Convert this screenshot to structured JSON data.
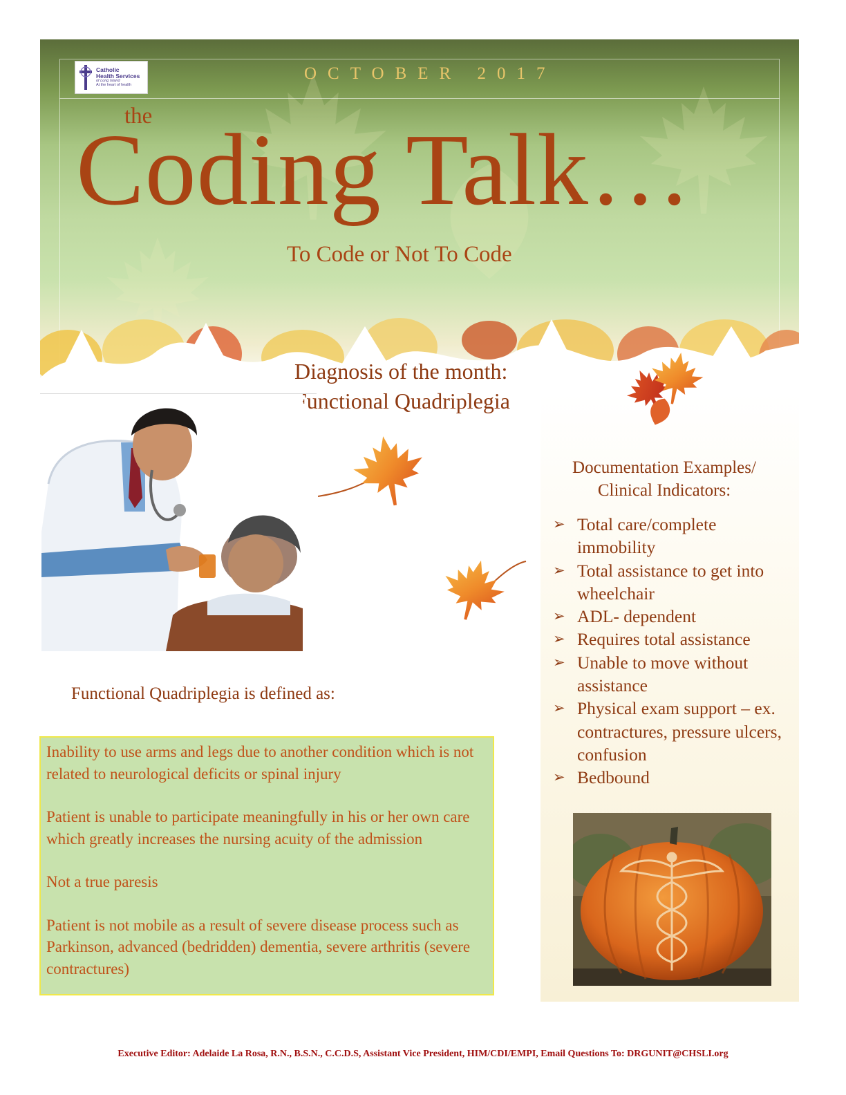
{
  "header": {
    "logo": {
      "line1": "Catholic",
      "line2": "Health Services",
      "line3": "of Long Island",
      "line4": "At the heart of health"
    },
    "date": "OCTOBER 2017",
    "title_prefix": "the",
    "title": "Coding Talk…",
    "subtitle": "To Code or Not To Code"
  },
  "diagnosis": {
    "line1": "Diagnosis of the month:",
    "line2": "Functional Quadriplegia"
  },
  "definition": {
    "heading": "Functional Quadriplegia is defined as:",
    "paragraphs": [
      "Inability to use arms and legs due to another condition which is not related to neurological deficits or spinal injury",
      "Patient is unable to participate meaningfully in his or her own care which greatly increases the nursing acuity of the admission",
      "Not a true paresis",
      "Patient is not mobile as a result of severe disease process such as Parkinson, advanced (bedridden) dementia, severe arthritis (severe contractures)"
    ]
  },
  "documentation": {
    "heading_line1": "Documentation Examples/",
    "heading_line2": "Clinical Indicators:",
    "items": [
      "Total care/complete immobility",
      "Total assistance to get into wheelchair",
      "ADL- dependent",
      "Requires total assistance",
      "Unable to move without assistance",
      "Physical exam support – ex. contractures, pressure ulcers, confusion",
      "Bedbound"
    ]
  },
  "footer": {
    "text": "Executive Editor: Adelaide La Rosa, R.N., B.S.N., C.C.D.S, Assistant Vice President, HIM/CDI/EMPI, Email Questions To: DRGUNIT@CHSLI.org"
  },
  "colors": {
    "title": "#a94414",
    "text": "#8e3a12",
    "box_bg": "#c8e2ad",
    "box_border": "#f0e84a",
    "box_text": "#c0521a",
    "footer": "#a01010",
    "date": "#e8c56a"
  },
  "icons": {
    "logo": "cross-logo-icon",
    "bullet": "arrowhead-bullet-icon",
    "decor": "maple-leaf-icon"
  }
}
